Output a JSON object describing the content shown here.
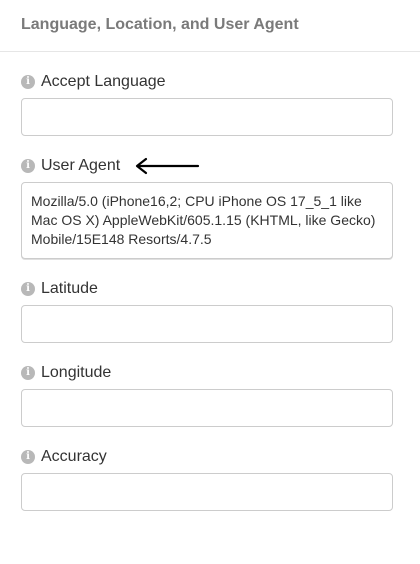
{
  "panel": {
    "title": "Language, Location, and User Agent"
  },
  "fields": {
    "accept_language": {
      "label": "Accept Language",
      "value": "",
      "info_icon": "info-icon"
    },
    "user_agent": {
      "label": "User Agent",
      "value": "Mozilla/5.0 (iPhone16,2; CPU iPhone OS 17_5_1 like Mac OS X) AppleWebKit/605.1.15 (KHTML, like Gecko) Mobile/15E148 Resorts/4.7.5",
      "info_icon": "info-icon",
      "annotation": "left-arrow"
    },
    "latitude": {
      "label": "Latitude",
      "value": "",
      "info_icon": "info-icon"
    },
    "longitude": {
      "label": "Longitude",
      "value": "",
      "info_icon": "info-icon"
    },
    "accuracy": {
      "label": "Accuracy",
      "value": "",
      "info_icon": "info-icon"
    }
  },
  "colors": {
    "title_text": "#7a7a7a",
    "label_text": "#333333",
    "input_border": "#cccccc",
    "info_icon_bg": "#b8b8b8",
    "annotation_arrow": "#000000"
  }
}
